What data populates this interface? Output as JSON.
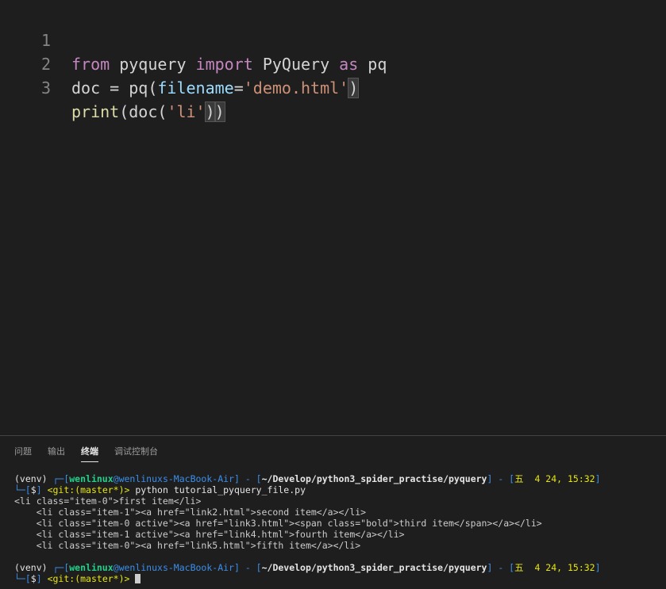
{
  "editor": {
    "lines": [
      {
        "num": "1",
        "tokens": {
          "t1": "from",
          "t2": " pyquery ",
          "t3": "import",
          "t4": " PyQuery ",
          "t5": "as",
          "t6": " pq"
        }
      },
      {
        "num": "2",
        "tokens": {
          "t1": "doc",
          "t2": " = ",
          "t3": "pq",
          "t4": "(",
          "t5": "filename",
          "t6": "=",
          "t7": "'demo.html'",
          "t8": ")"
        }
      },
      {
        "num": "3",
        "tokens": {
          "t1": "print",
          "t2": "(",
          "t3": "doc",
          "t4": "(",
          "t5": "'li'",
          "t6": ")",
          "t7": ")"
        }
      }
    ]
  },
  "panel": {
    "tabs": [
      "问题",
      "输出",
      "终端",
      "调试控制台"
    ],
    "active_tab": "终端"
  },
  "terminal": {
    "prompt1": {
      "venv": "(venv) ",
      "corner_top": "┌─[",
      "user": "wenlinux",
      "at_host": "@wenlinuxs-MacBook-Air",
      "sep1": "] - [",
      "path": "~/Develop/python3_spider_practise/pyquery",
      "sep2": "] - [",
      "date": "五  4 24, 15:32",
      "close": "]",
      "corner_bottom": "└─[",
      "dollar": "$",
      "close2": "] ",
      "git": "<git:(master*)>",
      "command": " python tutorial_pyquery_file.py"
    },
    "output": [
      "<li class=\"item-0\">first item</li>",
      "    <li class=\"item-1\"><a href=\"link2.html\">second item</a></li>",
      "    <li class=\"item-0 active\"><a href=\"link3.html\"><span class=\"bold\">third item</span></a></li>",
      "    <li class=\"item-1 active\"><a href=\"link4.html\">fourth item</a></li>",
      "    <li class=\"item-0\"><a href=\"link5.html\">fifth item</a></li>"
    ],
    "prompt2": {
      "venv": "(venv) ",
      "corner_top": "┌─[",
      "user": "wenlinux",
      "at_host": "@wenlinuxs-MacBook-Air",
      "sep1": "] - [",
      "path": "~/Develop/python3_spider_practise/pyquery",
      "sep2": "] - [",
      "date": "五  4 24, 15:32",
      "close": "]",
      "corner_bottom": "└─[",
      "dollar": "$",
      "close2": "] ",
      "git": "<git:(master*)>",
      "command": " "
    }
  },
  "colors": {
    "keyword": "#c586c0",
    "string": "#ce9178",
    "variable": "#9cdcfe",
    "function": "#dcdcaa",
    "terminal_blue": "#3b8eea",
    "terminal_green": "#23d18b",
    "terminal_yellow": "#e5e510"
  }
}
